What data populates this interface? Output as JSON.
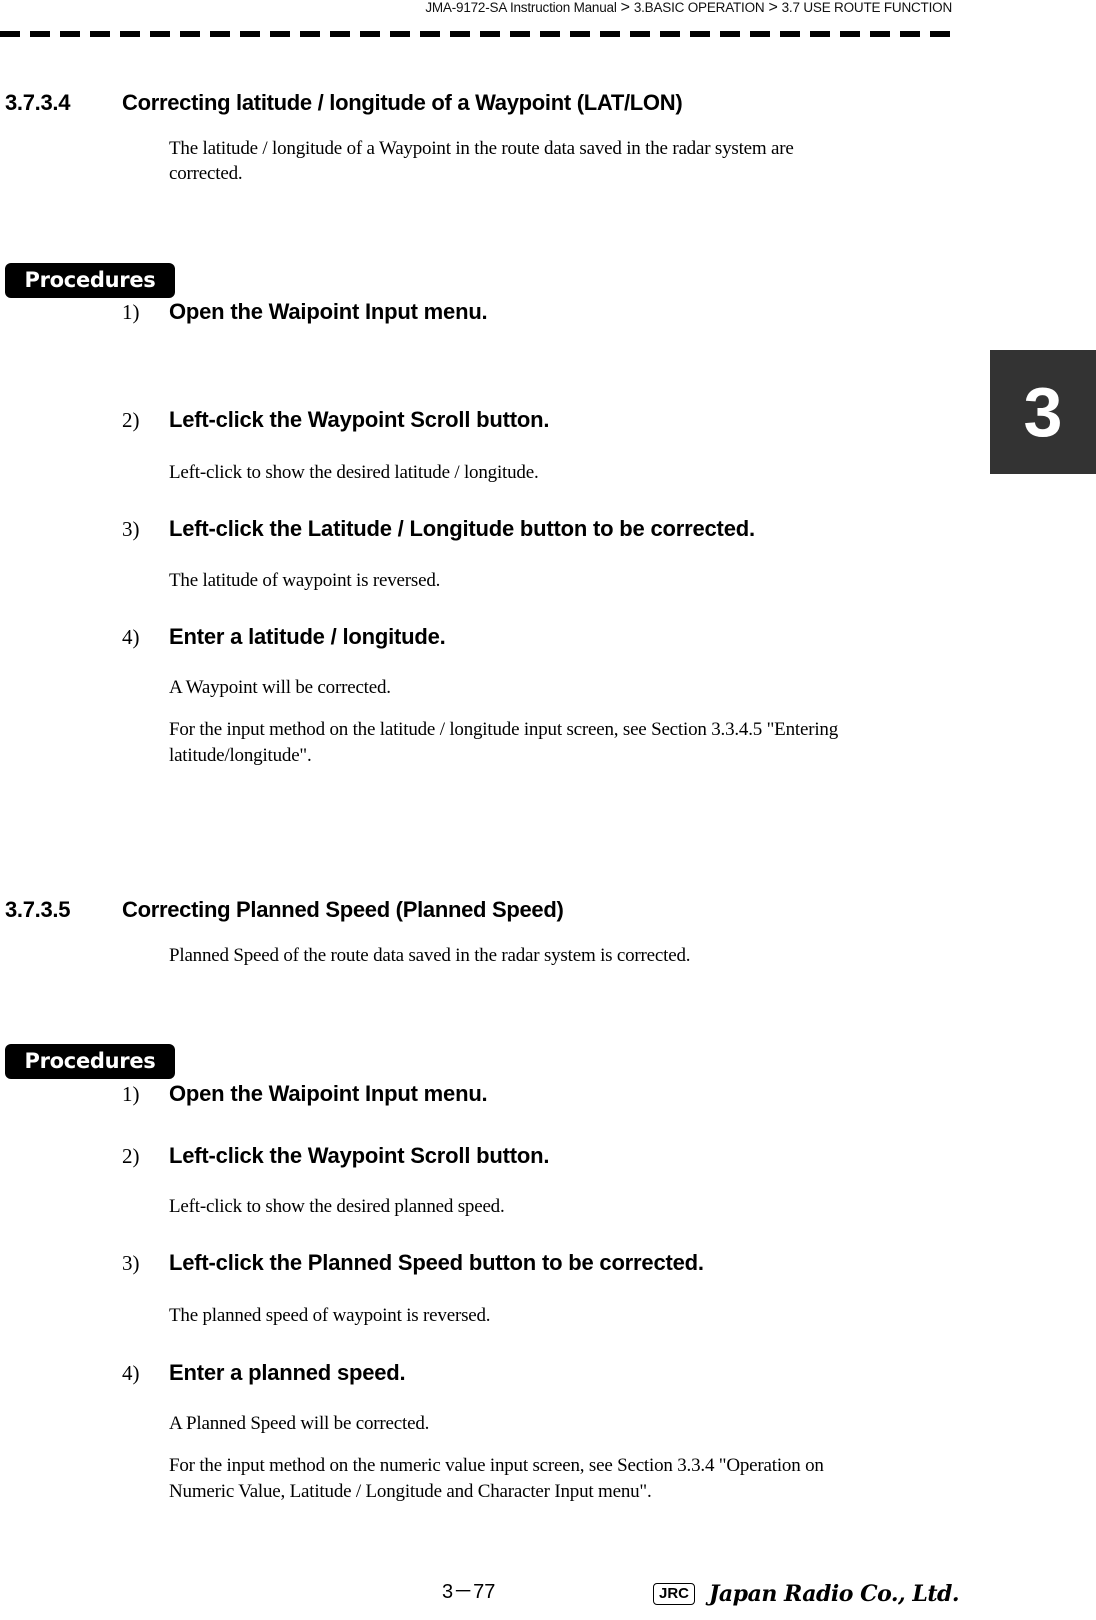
{
  "header": {
    "breadcrumb": [
      "JMA-9172-SA Instruction Manual",
      "3.BASIC OPERATION",
      "3.7  USE ROUTE FUNCTION"
    ],
    "separator": ">"
  },
  "chapter_tab": "3",
  "sections": [
    {
      "number": "3.7.3.4",
      "title": "Correcting latitude / longitude of a Waypoint (LAT/LON)",
      "intro": [
        "The latitude / longitude of a Waypoint in the route data saved in the radar system are",
        "corrected."
      ],
      "procedures_label": "Procedures",
      "steps": [
        {
          "num": "1)",
          "text": "Open the Waipoint Input menu.",
          "notes": []
        },
        {
          "num": "2)",
          "text": "Left-click the  Waypoint Scroll  button.",
          "notes": [
            "Left-click to show the desired latitude / longitude."
          ]
        },
        {
          "num": "3)",
          "text": "Left-click the  Latitude / Longitude  button to be corrected.",
          "notes": [
            "The latitude of waypoint is reversed."
          ]
        },
        {
          "num": "4)",
          "text": "Enter a latitude / longitude.",
          "notes": [
            "A Waypoint will be corrected.",
            "For the input method on the latitude / longitude input screen, see Section 3.3.4.5 \"Entering",
            "latitude/longitude\"."
          ]
        }
      ]
    },
    {
      "number": "3.7.3.5",
      "title": "Correcting Planned Speed (Planned Speed)",
      "intro": [
        "Planned Speed of the route data saved in the radar system is corrected."
      ],
      "procedures_label": "Procedures",
      "steps": [
        {
          "num": "1)",
          "text": "Open the Waipoint Input menu.",
          "notes": []
        },
        {
          "num": "2)",
          "text": "Left-click the  Waypoint Scroll  button.",
          "notes": [
            "Left-click to show the desired planned speed."
          ]
        },
        {
          "num": "3)",
          "text": "Left-click the  Planned Speed  button to be corrected.",
          "notes": [
            "The planned speed of waypoint is reversed."
          ]
        },
        {
          "num": "4)",
          "text": "Enter a planned speed.",
          "notes": [
            "A Planned Speed will be corrected.",
            "For the input method on the numeric value input screen, see Section 3.3.4 \"Operation on",
            "Numeric Value, Latitude / Longitude and Character Input menu\"."
          ]
        }
      ]
    }
  ],
  "footer": {
    "page_number": "3－77",
    "logo_badge": "JRC",
    "company": "Japan Radio Co., Ltd."
  }
}
